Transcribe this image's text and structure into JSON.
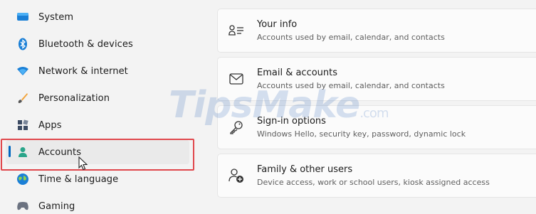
{
  "sidebar": {
    "items": [
      {
        "label": "System",
        "icon": "system-icon"
      },
      {
        "label": "Bluetooth & devices",
        "icon": "bluetooth-icon"
      },
      {
        "label": "Network & internet",
        "icon": "wifi-icon"
      },
      {
        "label": "Personalization",
        "icon": "brush-icon"
      },
      {
        "label": "Apps",
        "icon": "apps-icon"
      },
      {
        "label": "Accounts",
        "icon": "accounts-icon"
      },
      {
        "label": "Time & language",
        "icon": "globe-icon"
      },
      {
        "label": "Gaming",
        "icon": "gamepad-icon"
      }
    ],
    "selected": "Accounts"
  },
  "cards": [
    {
      "title": "Your info",
      "subtitle": "Accounts used by email, calendar, and contacts",
      "icon": "person-info-icon"
    },
    {
      "title": "Email & accounts",
      "subtitle": "Accounts used by email, calendar, and contacts",
      "icon": "mail-icon"
    },
    {
      "title": "Sign-in options",
      "subtitle": "Windows Hello, security key, password, dynamic lock",
      "icon": "key-icon"
    },
    {
      "title": "Family & other users",
      "subtitle": "Device access, work or school users, kiosk assigned access",
      "icon": "add-person-icon"
    }
  ],
  "watermark": {
    "text": "TipsMake",
    "suffix": ".com"
  },
  "colors": {
    "accent": "#0067c0",
    "highlight": "#e0474c",
    "background": "#f3f3f3"
  }
}
